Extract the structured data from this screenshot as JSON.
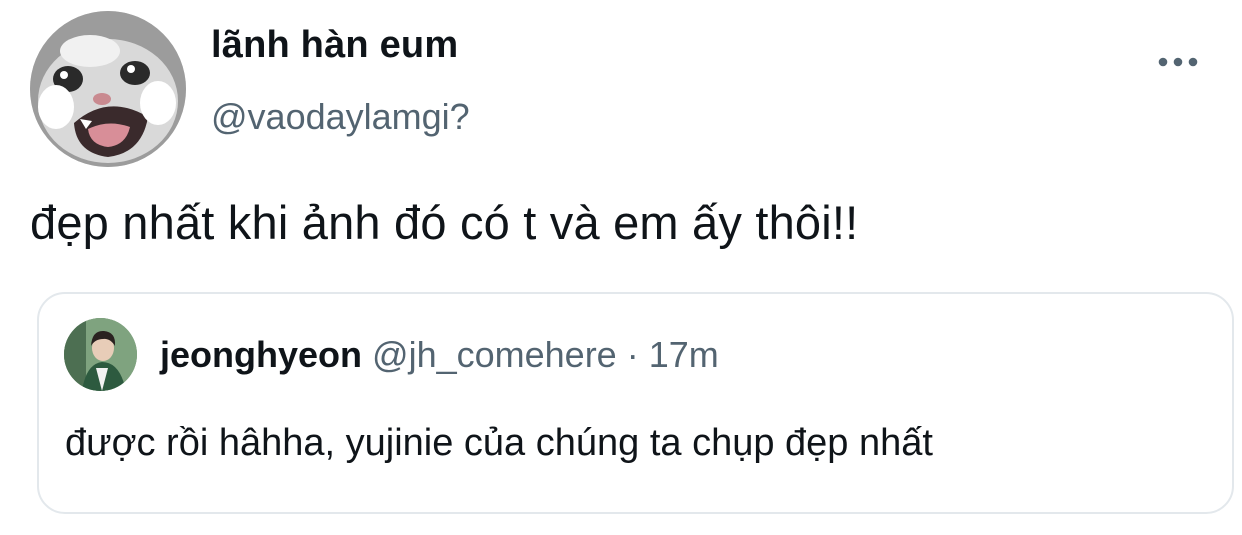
{
  "author": {
    "name": "lãnh hàn eum",
    "handle": "@vaodaylamgi?",
    "avatar_icon": "crying-cat-avatar"
  },
  "more_icon": "more-horizontal-icon",
  "tweet": {
    "text": "đẹp nhất khi ảnh đó có t và em ấy thôi!!"
  },
  "quoted": {
    "name": "jeonghyeon",
    "handle": "@jh_comehere",
    "separator": "·",
    "time": "17m",
    "text": "được rồi hâhha, yujinie của chúng ta chụp đẹp nhất",
    "avatar_icon": "person-avatar"
  },
  "colors": {
    "text_primary": "#0f1419",
    "text_secondary": "#536471",
    "border": "#e3e8ec"
  }
}
